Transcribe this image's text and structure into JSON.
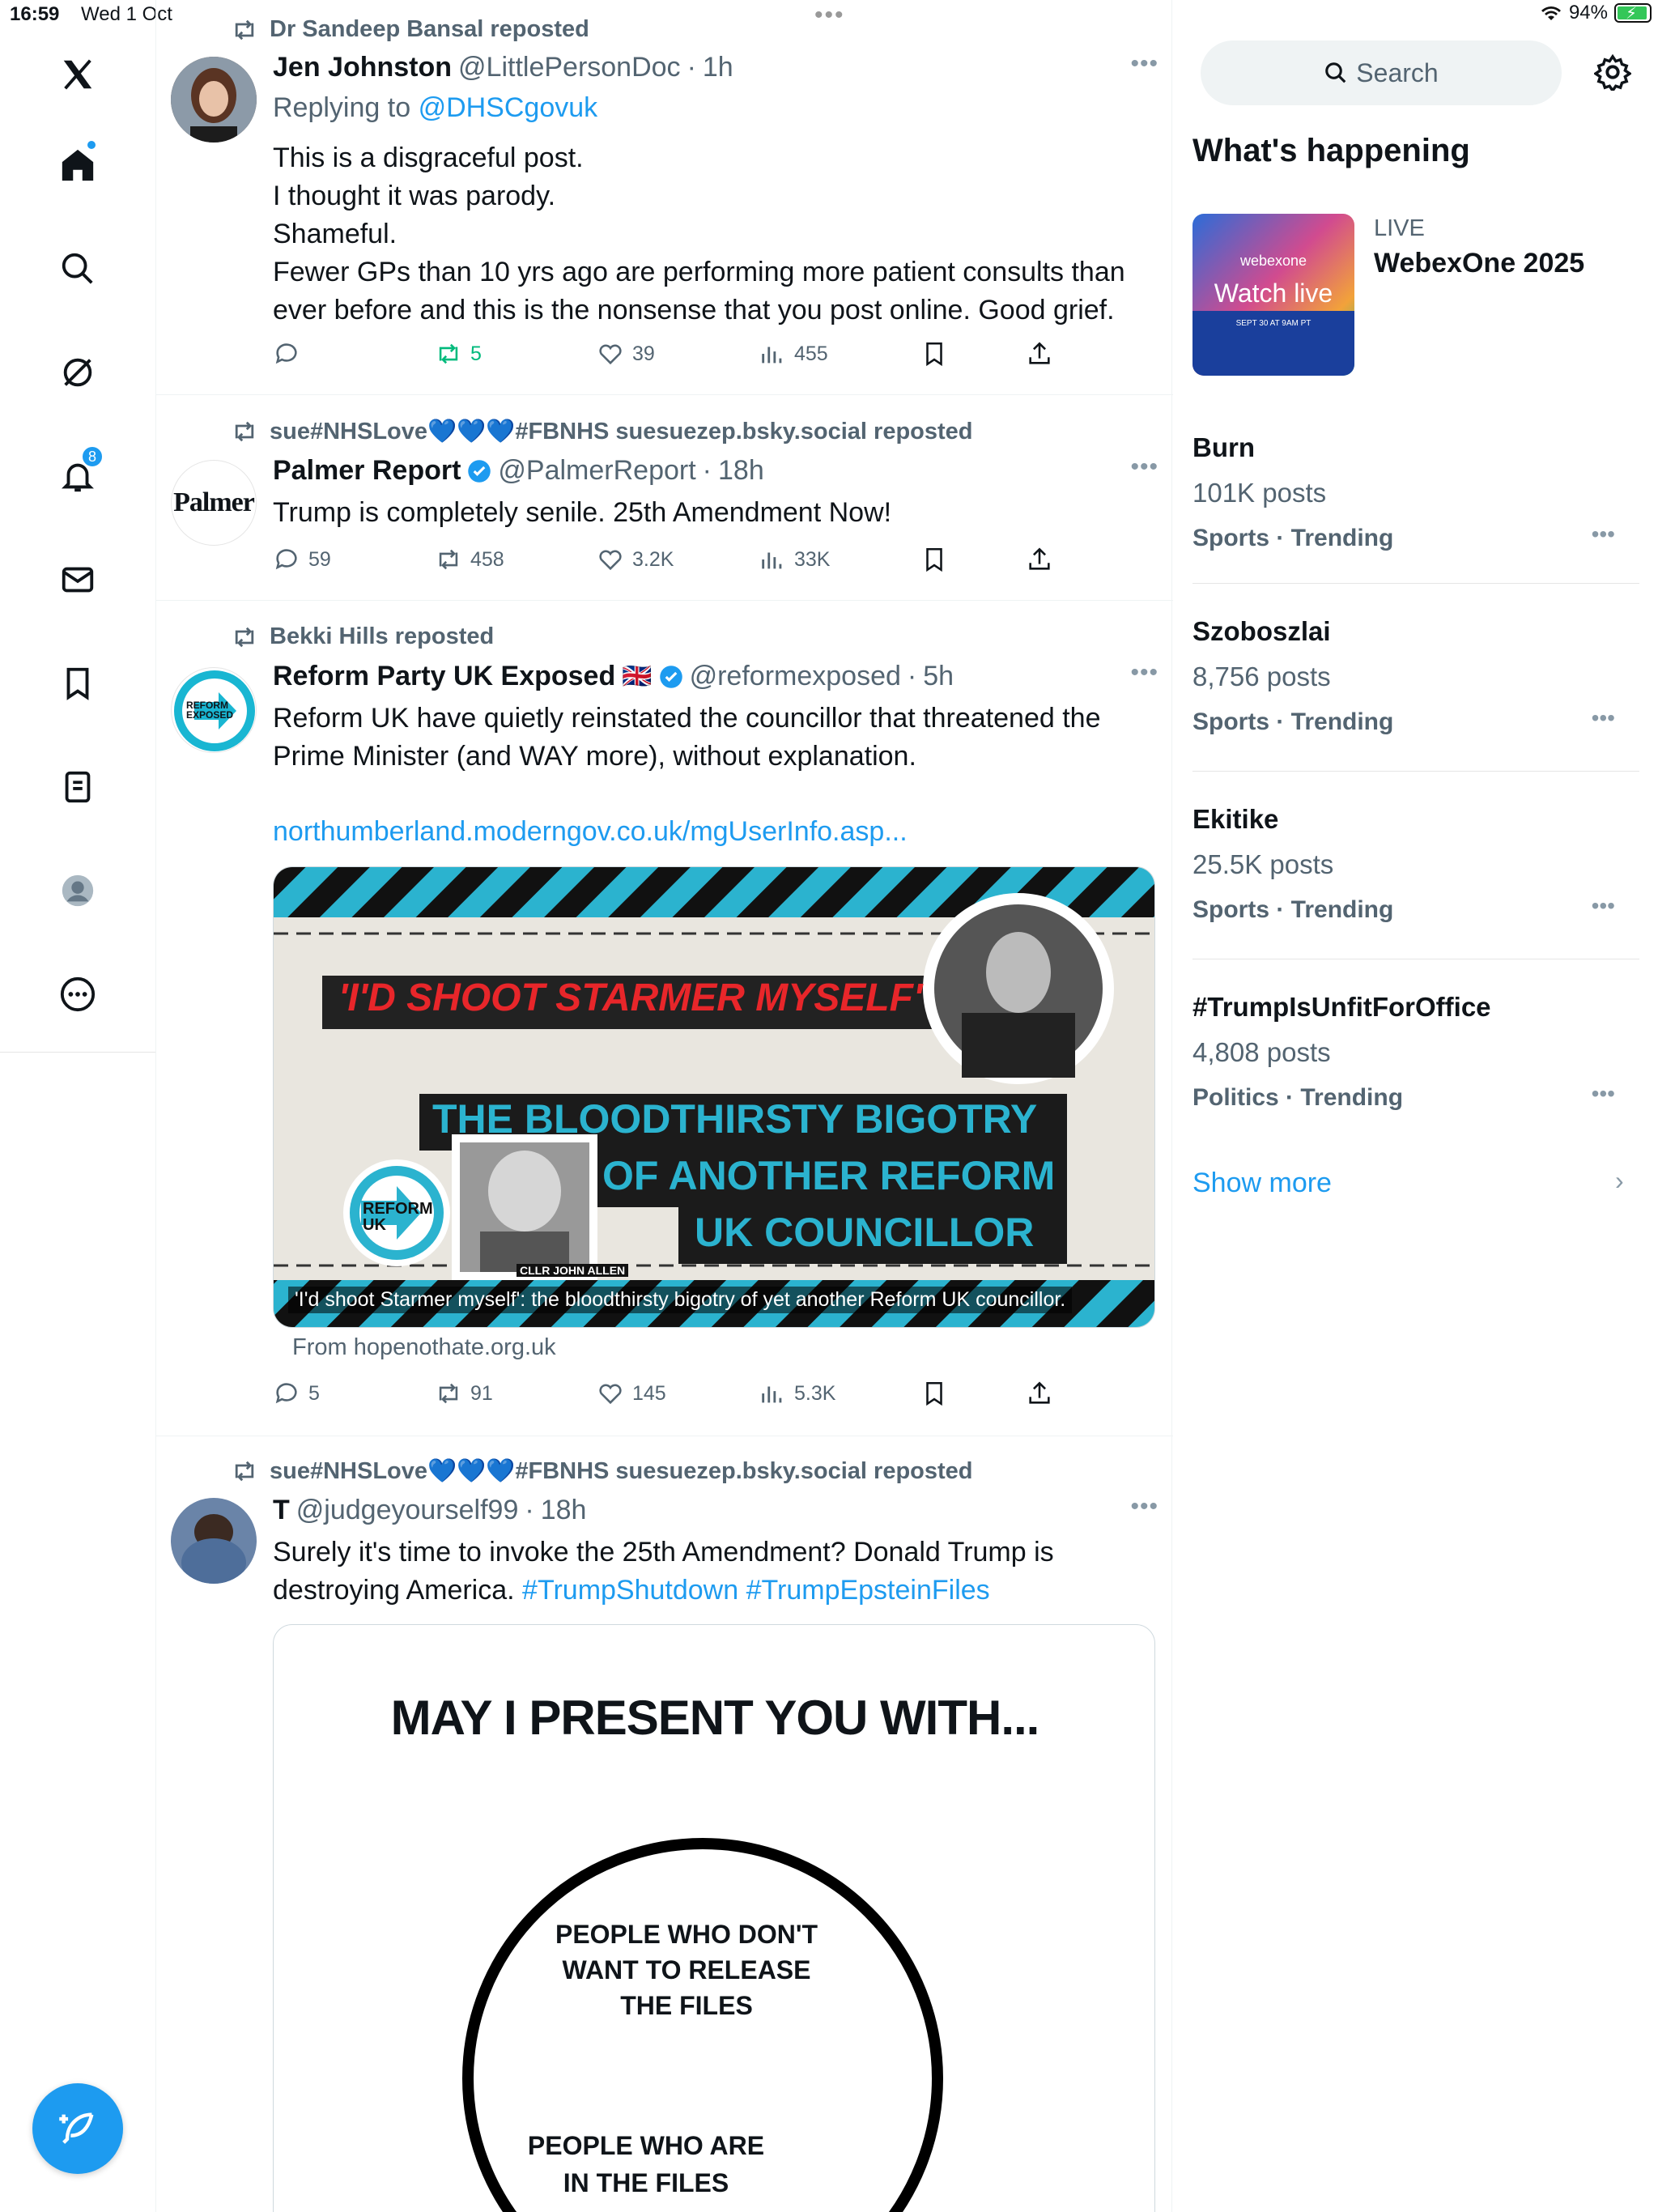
{
  "status": {
    "time": "16:59",
    "date": "Wed 1 Oct",
    "battery": "94%"
  },
  "nav": {
    "notification_count": "8"
  },
  "tweets": [
    {
      "reposter": "Dr Sandeep Bansal reposted",
      "name": "Jen Johnston",
      "handle": "@LittlePersonDoc",
      "time": "1h",
      "replying_prefix": "Replying to",
      "replying_to": "@DHSCgovuk",
      "body": [
        "This is a disgraceful post.",
        "I thought it was parody.",
        "Shameful.",
        "Fewer GPs than 10 yrs ago are performing more patient consults than ever before and this is the nonsense that you post online. Good grief."
      ],
      "replies": "",
      "reposts": "5",
      "likes": "39",
      "views": "455"
    },
    {
      "reposter": "sue#NHSLove💙💙💙#FBNHS suesuezep.bsky.social reposted",
      "name": "Palmer Report",
      "handle": "@PalmerReport",
      "time": "18h",
      "avatar_text": "Palmer",
      "body": "Trump is completely senile. 25th Amendment Now!",
      "replies": "59",
      "reposts": "458",
      "likes": "3.2K",
      "views": "33K"
    },
    {
      "reposter": "Bekki Hills reposted",
      "name": "Reform Party UK Exposed",
      "flag": "🇬🇧",
      "handle": "@reformexposed",
      "time": "5h",
      "avatar_text": "REFORM EXPOSED",
      "body": "Reform UK have quietly reinstated the councillor that threatened the Prime Minister (and WAY more), without explanation.",
      "link": "northumberland.moderngov.co.uk/mgUserInfo.asp...",
      "card": {
        "headline": "'I'D SHOOT STARMER MYSELF'",
        "line1": "THE BLOODTHIRSTY BIGOTRY",
        "line2": "OF ANOTHER REFORM",
        "line3": "UK COUNCILLOR",
        "logo": "REFORM UK",
        "tag": "CLLR JOHN ALLEN",
        "caption": "'I'd shoot Starmer myself': the bloodthirsty bigotry of yet another Reform UK councillor."
      },
      "from": "From hopenothate.org.uk",
      "replies": "5",
      "reposts": "91",
      "likes": "145",
      "views": "5.3K"
    },
    {
      "reposter": "sue#NHSLove💙💙💙#FBNHS suesuezep.bsky.social reposted",
      "name": "T",
      "handle": "@judgeyourself99",
      "time": "18h",
      "body_text": "Surely it's time to invoke the 25th Amendment? Donald Trump is destroying America.",
      "hashtags": "#TrumpShutdown #TrumpEpsteinFiles",
      "image": {
        "title": "MAY I PRESENT YOU WITH...",
        "circle1": [
          "PEOPLE WHO DON'T",
          "WANT TO RELEASE",
          "THE FILES"
        ],
        "circle2": [
          "PEOPLE WHO ARE",
          "IN THE FILES"
        ]
      }
    }
  ],
  "sidebar": {
    "search_label": "Search",
    "title": "What's happening",
    "event": {
      "status": "LIVE",
      "title": "WebexOne 2025",
      "img_brand": "webexone",
      "img_cta": "Watch live",
      "img_date": "SEPT 30 AT 9AM PT"
    },
    "trends": [
      {
        "name": "Burn",
        "posts": "101K posts",
        "category": "Sports · Trending"
      },
      {
        "name": "Szoboszlai",
        "posts": "8,756 posts",
        "category": "Sports · Trending"
      },
      {
        "name": "Ekitike",
        "posts": "25.5K posts",
        "category": "Sports · Trending"
      },
      {
        "name": "#TrumpIsUnfitForOffice",
        "posts": "4,808 posts",
        "category": "Politics · Trending"
      }
    ],
    "show_more": "Show more"
  },
  "colors": {
    "accent": "#1d9bf0",
    "secondary_text": "#536471",
    "repost_green": "#00ba7c"
  }
}
